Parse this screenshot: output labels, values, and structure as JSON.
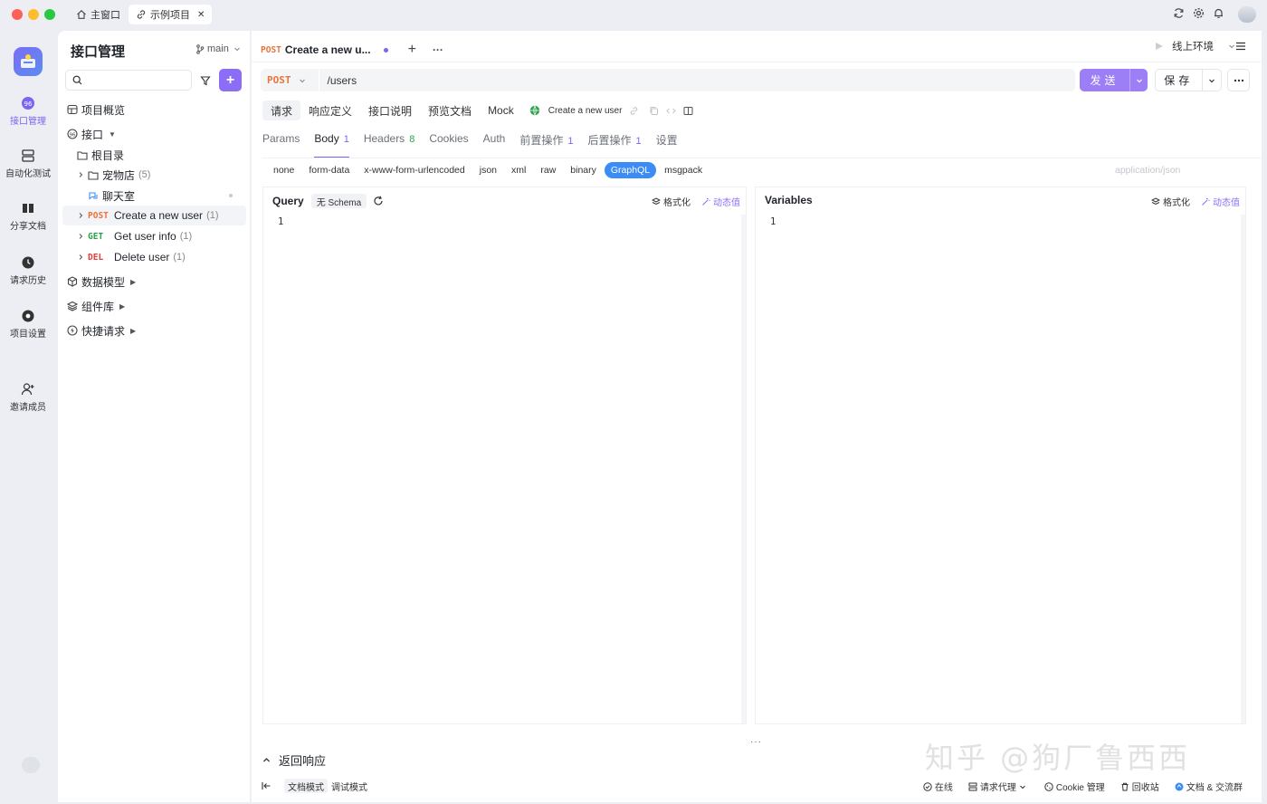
{
  "window": {
    "tabs": [
      {
        "label": "主窗口",
        "icon": "home-icon"
      },
      {
        "label": "示例项目",
        "icon": "link-icon",
        "close": "✕"
      }
    ]
  },
  "rail": {
    "items": [
      {
        "label": "接口管理",
        "icon": "api-icon",
        "active": true
      },
      {
        "label": "自动化测试",
        "icon": "automation-icon"
      },
      {
        "label": "分享文档",
        "icon": "book-icon"
      },
      {
        "label": "请求历史",
        "icon": "clock-icon"
      },
      {
        "label": "项目设置",
        "icon": "settings-icon"
      },
      {
        "label": "邀请成员",
        "icon": "invite-user-icon"
      }
    ]
  },
  "sidebar": {
    "title": "接口管理",
    "branch": "main",
    "search_placeholder": "",
    "add_label": "+",
    "tree": {
      "overview": "项目概览",
      "interfaces": "接口",
      "root": "根目录",
      "pet_store": {
        "label": "宠物店",
        "count": "(5)"
      },
      "chat_room": "聊天室",
      "endpoints": [
        {
          "method": "POST",
          "name": "Create a new user",
          "count": "(1)"
        },
        {
          "method": "GET",
          "name": "Get user info",
          "count": "(1)"
        },
        {
          "method": "DEL",
          "name": "Delete user",
          "count": "(1)"
        }
      ],
      "data_models": "数据模型",
      "components": "组件库",
      "quick_requests": "快捷请求"
    }
  },
  "main": {
    "tab": {
      "method": "POST",
      "title": "Create a new u...",
      "add": "+",
      "more": "···"
    },
    "env": "线上环境",
    "url": {
      "method": "POST",
      "path": "/users"
    },
    "send_label": "发送",
    "save_label": "保存",
    "subtabs": [
      "请求",
      "响应定义",
      "接口说明",
      "预览文档",
      "Mock"
    ],
    "endpoint_name": "Create a new user",
    "param_tabs": [
      {
        "label": "Params",
        "count": ""
      },
      {
        "label": "Body",
        "count": "1",
        "active": true
      },
      {
        "label": "Headers",
        "count": "8"
      },
      {
        "label": "Cookies",
        "count": ""
      },
      {
        "label": "Auth",
        "count": ""
      },
      {
        "label": "前置操作",
        "count": "1"
      },
      {
        "label": "后置操作",
        "count": "1"
      },
      {
        "label": "设置",
        "count": ""
      }
    ],
    "body_types": [
      "none",
      "form-data",
      "x-www-form-urlencoded",
      "json",
      "xml",
      "raw",
      "binary",
      "GraphQL",
      "msgpack"
    ],
    "body_type_active": "GraphQL",
    "content_type": "application/json",
    "query": {
      "title": "Query",
      "schema": "无 Schema",
      "format": "格式化",
      "dynamic": "动态值",
      "line": "1"
    },
    "variables": {
      "title": "Variables",
      "format": "格式化",
      "dynamic": "动态值",
      "line": "1"
    },
    "response_label": "返回响应",
    "drag_handle": "···",
    "footer": {
      "modes": [
        "文档模式",
        "调试模式"
      ],
      "online": "在线",
      "proxy": "请求代理",
      "cookie": "Cookie 管理",
      "recycle": "回收站",
      "docs": "文档 & 交流群"
    },
    "watermark": "知乎 @狗厂鲁西西"
  },
  "colors": {
    "accent": "#7c64f0",
    "send": "#9c7ff7",
    "post": "#e8743b",
    "get": "#2ea24a",
    "del": "#e0403a",
    "graphql": "#3b8cf5"
  }
}
